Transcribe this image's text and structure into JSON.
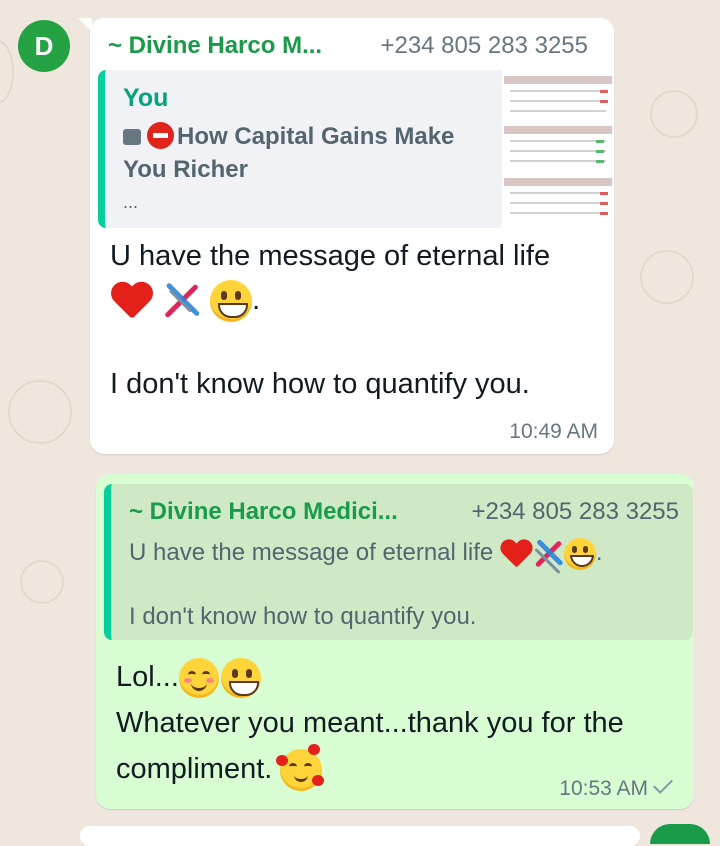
{
  "avatar": {
    "letter": "D",
    "color": "#25a244"
  },
  "incoming": {
    "sender_name": "~ Divine Harco M...",
    "sender_phone": "+234 805 283 3255",
    "quote": {
      "author": "You",
      "icons": [
        "image-icon",
        "stop-sign-icon"
      ],
      "title": "How Capital Gains Make You Richer",
      "ellipsis": "..."
    },
    "text_line1": "U have the message of eternal life",
    "emojis": [
      "red-heart-emoji",
      "dna-emoji",
      "grinning-face-emoji"
    ],
    "after_emojis": ".",
    "text_line2": "I don't know how to quantify you.",
    "time": "10:49 AM"
  },
  "outgoing": {
    "quote": {
      "sender_name": "~ Divine Harco Medici...",
      "sender_phone": "+234 805 283 3255",
      "text_line1": "U have the message of eternal life",
      "after_emojis": ".",
      "text_line2": "I don't know how to quantify you."
    },
    "line1_prefix": "Lol...",
    "line2": "Whatever you meant...thank you for the",
    "line3": "compliment.",
    "time": "10:53 AM",
    "status": "sent-check-icon"
  },
  "colors": {
    "background": "#efe7de",
    "incoming_bubble": "#ffffff",
    "outgoing_bubble": "#d9fdd3",
    "accent_green": "#1a9b4a",
    "quote_bar": "#06cf9c"
  }
}
